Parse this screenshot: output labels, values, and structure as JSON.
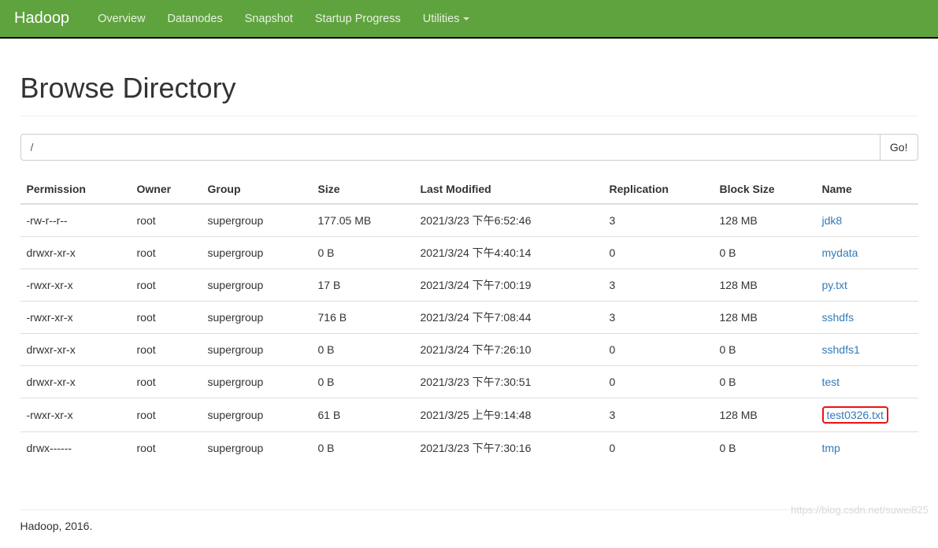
{
  "nav": {
    "brand": "Hadoop",
    "items": [
      "Overview",
      "Datanodes",
      "Snapshot",
      "Startup Progress",
      "Utilities"
    ]
  },
  "page": {
    "title": "Browse Directory",
    "path_value": "/",
    "go_label": "Go!"
  },
  "table": {
    "headers": {
      "permission": "Permission",
      "owner": "Owner",
      "group": "Group",
      "size": "Size",
      "last_modified": "Last Modified",
      "replication": "Replication",
      "block_size": "Block Size",
      "name": "Name"
    },
    "rows": [
      {
        "permission": "-rw-r--r--",
        "owner": "root",
        "group": "supergroup",
        "size": "177.05 MB",
        "last_modified": "2021/3/23 下午6:52:46",
        "replication": "3",
        "block_size": "128 MB",
        "name": "jdk8",
        "highlight": false
      },
      {
        "permission": "drwxr-xr-x",
        "owner": "root",
        "group": "supergroup",
        "size": "0 B",
        "last_modified": "2021/3/24 下午4:40:14",
        "replication": "0",
        "block_size": "0 B",
        "name": "mydata",
        "highlight": false
      },
      {
        "permission": "-rwxr-xr-x",
        "owner": "root",
        "group": "supergroup",
        "size": "17 B",
        "last_modified": "2021/3/24 下午7:00:19",
        "replication": "3",
        "block_size": "128 MB",
        "name": "py.txt",
        "highlight": false
      },
      {
        "permission": "-rwxr-xr-x",
        "owner": "root",
        "group": "supergroup",
        "size": "716 B",
        "last_modified": "2021/3/24 下午7:08:44",
        "replication": "3",
        "block_size": "128 MB",
        "name": "sshdfs",
        "highlight": false
      },
      {
        "permission": "drwxr-xr-x",
        "owner": "root",
        "group": "supergroup",
        "size": "0 B",
        "last_modified": "2021/3/24 下午7:26:10",
        "replication": "0",
        "block_size": "0 B",
        "name": "sshdfs1",
        "highlight": false
      },
      {
        "permission": "drwxr-xr-x",
        "owner": "root",
        "group": "supergroup",
        "size": "0 B",
        "last_modified": "2021/3/23 下午7:30:51",
        "replication": "0",
        "block_size": "0 B",
        "name": "test",
        "highlight": false
      },
      {
        "permission": "-rwxr-xr-x",
        "owner": "root",
        "group": "supergroup",
        "size": "61 B",
        "last_modified": "2021/3/25 上午9:14:48",
        "replication": "3",
        "block_size": "128 MB",
        "name": "test0326.txt",
        "highlight": true
      },
      {
        "permission": "drwx------",
        "owner": "root",
        "group": "supergroup",
        "size": "0 B",
        "last_modified": "2021/3/23 下午7:30:16",
        "replication": "0",
        "block_size": "0 B",
        "name": "tmp",
        "highlight": false
      }
    ]
  },
  "footer": "Hadoop, 2016.",
  "watermark": "https://blog.csdn.net/suwei825"
}
